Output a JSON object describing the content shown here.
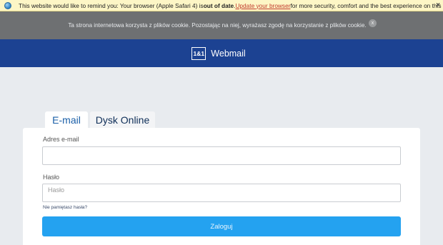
{
  "browser_warning": {
    "prefix": "This website would like to remind you: Your browser (Apple Safari 4) is ",
    "bold": "out of date",
    "middle": ". ",
    "link": "Update your browser",
    "suffix": " for more security, comfort and the best experience on this site.",
    "close": "×"
  },
  "cookie": {
    "text": "Ta strona internetowa korzysta z plików cookie. Pozostając na niej, wyrażasz zgodę na korzystanie z plików cookie.",
    "close": "x"
  },
  "header": {
    "logo": "1&1",
    "title": "Webmail"
  },
  "tabs": [
    {
      "label": "E-mail",
      "active": true
    },
    {
      "label": "Dysk Online",
      "active": false
    }
  ],
  "form": {
    "email_label": "Adres e-mail",
    "email_value": "",
    "password_label": "Hasło",
    "password_placeholder": "Hasło",
    "forgot_link": "Nie pamiętasz hasła?",
    "submit_label": "Zaloguj"
  },
  "colors": {
    "header": "#1c4292",
    "button": "#24a2f0",
    "cookie_bar": "#6e7072",
    "warning_bar": "#fdf6c6"
  }
}
